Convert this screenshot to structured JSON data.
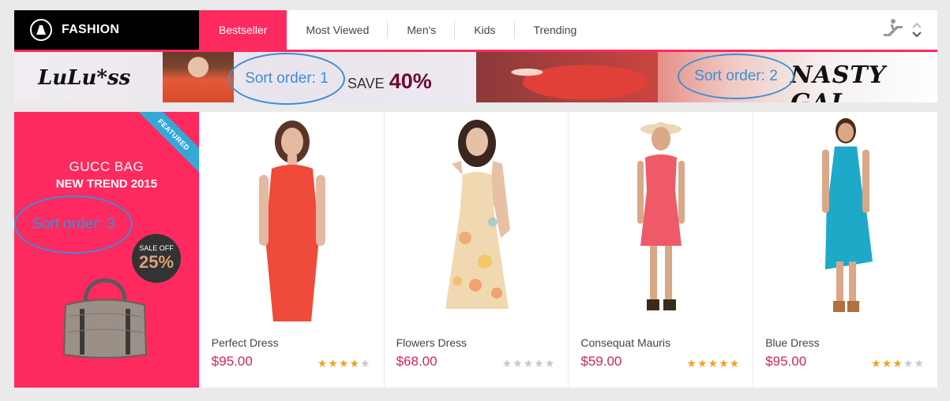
{
  "brand": {
    "name": "FASHION",
    "logo": "shirt-icon"
  },
  "tabs": [
    {
      "label": "Bestseller",
      "active": true
    },
    {
      "label": "Most Viewed",
      "active": false
    },
    {
      "label": "Men's",
      "active": false
    },
    {
      "label": "Kids",
      "active": false
    },
    {
      "label": "Trending",
      "active": false
    }
  ],
  "tools": {
    "icon": "escalator-icon",
    "up": "chevron-up-icon",
    "down": "chevron-down-icon"
  },
  "banners": {
    "banner1": {
      "brand": "LuLu*ss",
      "save_text": "SAVE",
      "save_value": "40%"
    },
    "banner2": {
      "brand": "NASTY GAL"
    }
  },
  "annotations": {
    "a1": "Sort order: 1",
    "a2": "Sort order: 2",
    "a3": "Sort order: 3"
  },
  "promo": {
    "title1": "GUCC BAG",
    "title2": "NEW TREND 2015",
    "sale_label": "SALE OFF",
    "sale_value": "25%",
    "ribbon": "FEATURED"
  },
  "products": [
    {
      "name": "Perfect Dress",
      "price": "$95.00",
      "rating": 4,
      "color": "#ef4a3a"
    },
    {
      "name": "Flowers Dress",
      "price": "$68.00",
      "rating": 0,
      "color": "#f0d9b0"
    },
    {
      "name": "Consequat Mauris",
      "price": "$59.00",
      "rating": 5,
      "color": "#ef5a68"
    },
    {
      "name": "Blue Dress",
      "price": "$95.00",
      "rating": 3,
      "color": "#1ea9c9"
    }
  ],
  "colors": {
    "accent": "#fd2a5f",
    "price": "#d2245e",
    "star": "#f1a125",
    "annotation": "#3a8fd8"
  }
}
